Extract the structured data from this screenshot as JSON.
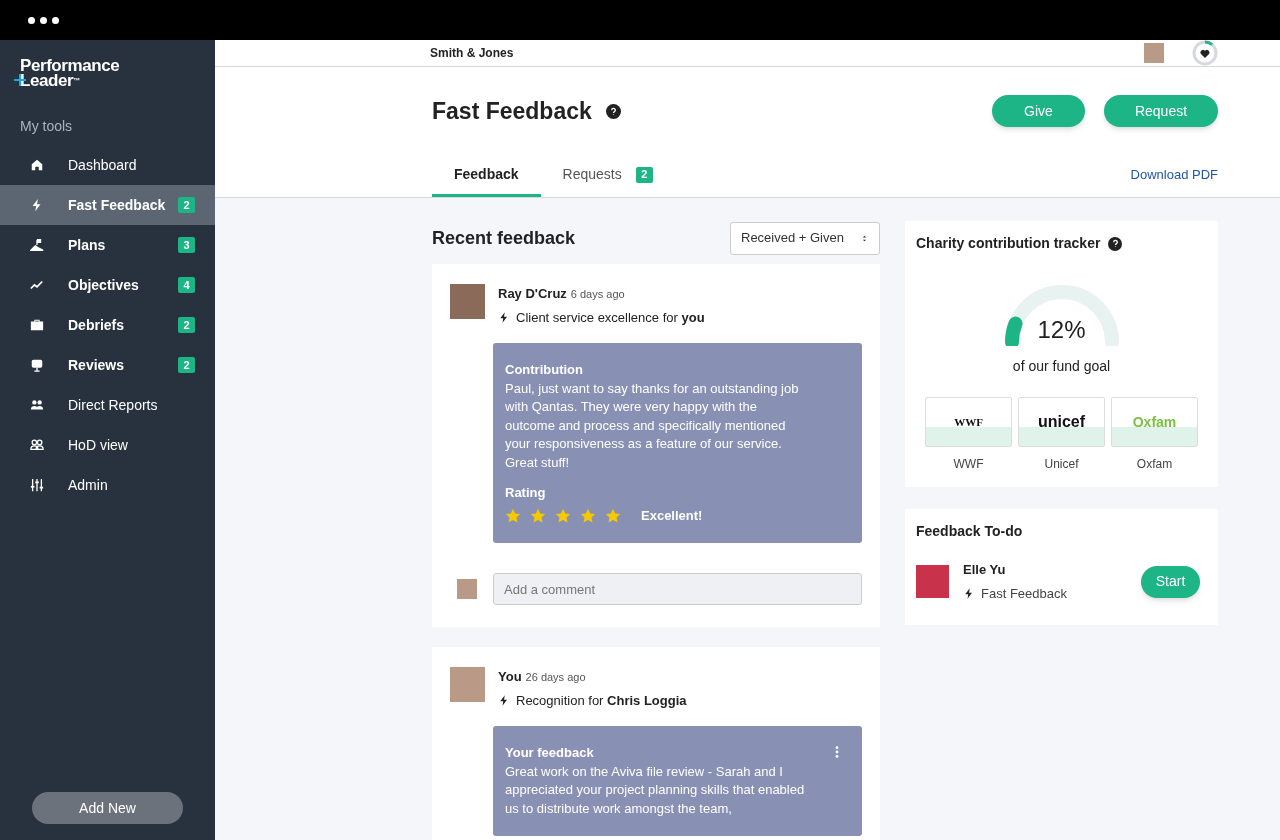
{
  "logo": {
    "lines": [
      "Performance",
      "Leader"
    ],
    "mark": "™"
  },
  "sidebar": {
    "heading": "My tools",
    "items": [
      {
        "label": "Dashboard",
        "selected": false
      },
      {
        "label": "Fast Feedback",
        "badge": "2",
        "selected": true
      },
      {
        "label": "Plans",
        "badge": "3",
        "selected": false
      },
      {
        "label": "Objectives",
        "badge": "4",
        "selected": false
      },
      {
        "label": "Debriefs",
        "badge": "2",
        "selected": false
      },
      {
        "label": "Reviews",
        "badge": "2",
        "selected": false
      },
      {
        "label": "Direct Reports",
        "selected": false
      },
      {
        "label": "HoD view",
        "selected": false
      },
      {
        "label": "Admin",
        "selected": false
      }
    ],
    "add_button": "Add New"
  },
  "topbar": {
    "company": "Smith & Jones"
  },
  "page": {
    "title": "Fast Feedback",
    "buttons": [
      "Give",
      "Request"
    ],
    "tabs": [
      {
        "label": "Feedback",
        "selected": true
      },
      {
        "label": "Requests",
        "badge": "2",
        "selected": false
      }
    ],
    "download_link": "Download PDF"
  },
  "feed": {
    "title": "Recent feedback",
    "filter": "Received + Given",
    "items": [
      {
        "author": "Ray D'Cruz",
        "time": "6 days ago",
        "subject": "Client service excellence for **you**",
        "section": "Contribution",
        "body": "Paul, just want to say thanks for an outstanding job with Qantas. They were very happy with the outcome and process and specifically mentioned your responsiveness as a feature of our service. Great stuff!",
        "rating_label": "Rating",
        "stars": 5,
        "rating_text": "Excellent!",
        "comment_placeholder": "Add a comment",
        "menu": false
      },
      {
        "author": "You",
        "time": "26 days ago",
        "subject": "Recognition for **Chris Loggia**",
        "section": "Your feedback",
        "body": "Great work on the Aviva file review - Sarah and I appreciated your project planning skills that enabled us to distribute work amongst the team,",
        "menu": true
      }
    ]
  },
  "charity": {
    "title": "Charity contribution tracker",
    "level": 0.12,
    "percent": "12%",
    "caption": "of our fund goal",
    "charities": [
      {
        "logo_text": "WWF",
        "name": "WWF"
      },
      {
        "logo_text": "unicef",
        "name": "Unicef"
      },
      {
        "logo_text": "Oxfam",
        "name": "Oxfam"
      }
    ]
  },
  "todo": {
    "title": "Feedback To-do",
    "items": [
      {
        "name": "Elle Yu",
        "type": "Fast Feedback",
        "button": "Start"
      }
    ]
  }
}
